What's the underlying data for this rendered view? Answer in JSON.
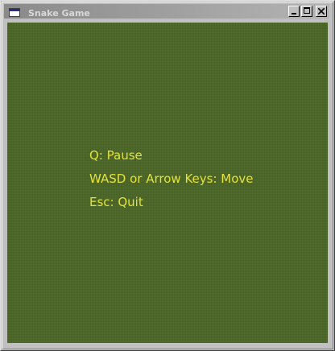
{
  "window": {
    "title": "Snake Game",
    "icon": "window-icon",
    "buttons": {
      "minimize": "minimize-icon",
      "maximize": "maximize-icon",
      "close": "close-icon"
    }
  },
  "game": {
    "background_color": "#4b6528",
    "text_color": "#e2e23a",
    "instructions": [
      "Q: Pause",
      "WASD or Arrow Keys: Move",
      "Esc: Quit"
    ]
  }
}
